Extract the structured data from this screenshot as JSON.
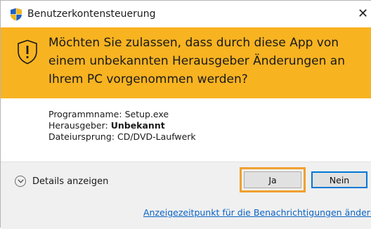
{
  "window": {
    "title": "Benutzerkontensteuerung",
    "close_icon": "close-icon"
  },
  "banner": {
    "message": "Möchten Sie zulassen, dass durch diese App von einem unbekannten Herausgeber Änderungen an Ihrem PC vorgenommen werden?",
    "icon": "warning-shield-icon",
    "color": "#f8b321"
  },
  "info": {
    "program_label": "Programmname:",
    "program_value": "Setup.exe",
    "publisher_label": "Herausgeber:",
    "publisher_value": "Unbekannt",
    "origin_label": "Dateiursprung:",
    "origin_value": "CD/DVD-Laufwerk"
  },
  "footer": {
    "details_label": "Details anzeigen",
    "yes_label": "Ja",
    "no_label": "Nein",
    "link_text": "Anzeigezeitpunkt für die Benachrichtigungen ändern",
    "highlight_color": "#f0a030",
    "link_color": "#0b63c5"
  }
}
